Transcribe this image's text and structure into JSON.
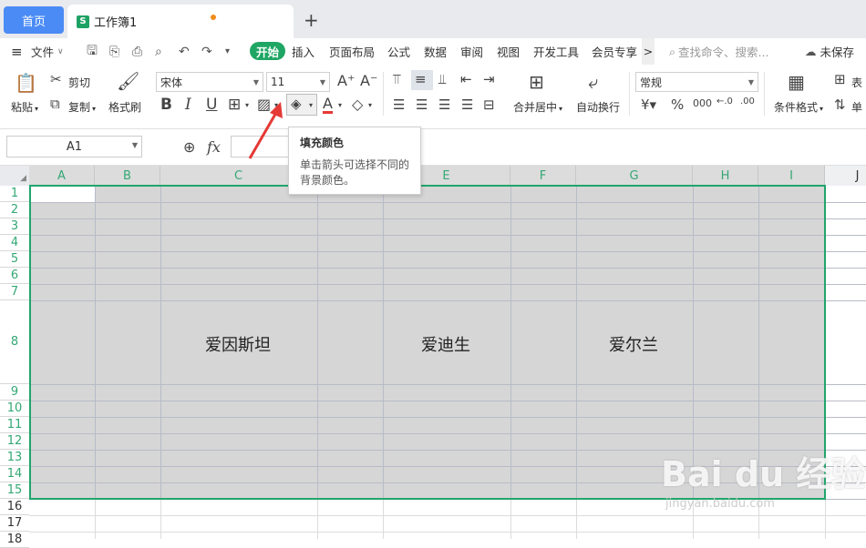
{
  "tabs": {
    "home": "首页",
    "workbook": "工作簿1",
    "add": "+"
  },
  "menu": {
    "hamburger": "≡",
    "file": "文件",
    "items": [
      "开始",
      "插入",
      "页面布局",
      "公式",
      "数据",
      "审阅",
      "视图",
      "开发工具",
      "会员专享"
    ],
    "more": ">",
    "search_placeholder": "查找命令、搜索...",
    "unsaved": "未保存"
  },
  "toolbar": {
    "paste": "粘贴",
    "cut": "剪切",
    "copy": "复制",
    "format_painter": "格式刷",
    "font_name": "宋体",
    "font_size": "11",
    "bold": "B",
    "italic": "I",
    "underline": "U",
    "merge_center": "合并居中",
    "wrap_text": "自动换行",
    "number_format": "常规",
    "percent": "%",
    "thousands": "000",
    "conditional_format": "条件格式",
    "table_style": "表",
    "cell": "单"
  },
  "tooltip": {
    "title": "填充颜色",
    "desc1": "单击箭头可选择不同的",
    "desc2": "背景颜色。"
  },
  "formula_bar": {
    "name_box": "A1",
    "fx": "fx"
  },
  "columns": [
    "A",
    "B",
    "C",
    "D",
    "E",
    "F",
    "G",
    "H",
    "I",
    "J"
  ],
  "rows": [
    "1",
    "2",
    "3",
    "4",
    "5",
    "6",
    "7",
    "8",
    "9",
    "10",
    "11",
    "12",
    "13",
    "14",
    "15",
    "16",
    "17",
    "18"
  ],
  "cells": {
    "C8": "爱因斯坦",
    "E8": "爱迪生",
    "G8": "爱尔兰"
  },
  "watermark": {
    "main": "Bai du 经验",
    "sub": "jingyan.baidu.com"
  },
  "colors": {
    "accent_green": "#1fa664",
    "home_tab": "#4b8bf5",
    "selection_fill": "#d6d6d6",
    "tooltip_arrow": "#e53935"
  }
}
